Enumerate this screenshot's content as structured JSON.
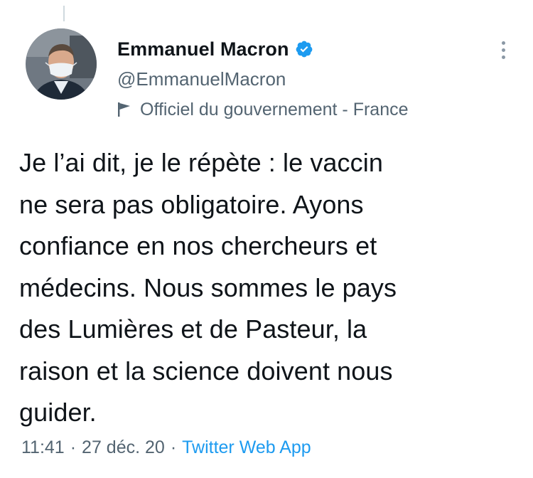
{
  "author": {
    "display_name": "Emmanuel Macron",
    "handle": "@EmmanuelMacron",
    "verified": true,
    "affiliation": "Officiel du gouvernement - France",
    "avatar_icon": "profile-photo-masked-man"
  },
  "tweet": {
    "text": "Je l’ai dit, je le répète : le vaccin\nne sera pas obligatoire. Ayons\nconfiance en nos chercheurs et\nmédecins. Nous sommes le pays\ndes Lumières et de Pasteur, la\nraison et la science doivent nous\nguider."
  },
  "meta": {
    "time": "11:41",
    "separator": "·",
    "date": "27 déc. 20",
    "source": "Twitter Web App"
  },
  "colors": {
    "text": "#0f1419",
    "secondary": "#536471",
    "accent": "#1d9bf0"
  }
}
